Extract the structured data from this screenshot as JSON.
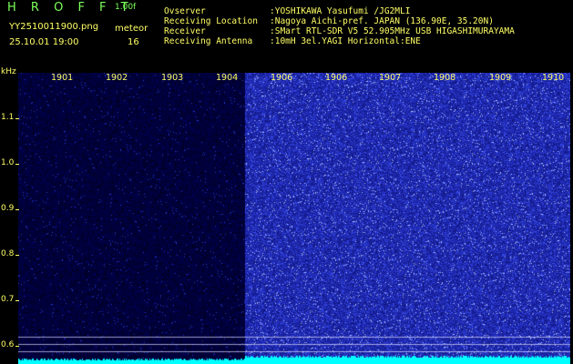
{
  "header": {
    "app_logo": "H R O F F T",
    "version": "1.00f",
    "filename": "YY2510011900.png",
    "meteor_label": "meteor",
    "datetime": "25.10.01 19:00",
    "meteor_count": "16"
  },
  "info": [
    {
      "key": "Ovserver",
      "value": ":YOSHIKAWA Yasufumi /JG2MLI"
    },
    {
      "key": "Receiving Location",
      "value": ":Nagoya Aichi-pref. JAPAN (136.90E, 35.20N)"
    },
    {
      "key": "Receiver",
      "value": ":SMart RTL-SDR V5 52.905MHz USB HIGASHIMURAYAMA"
    },
    {
      "key": "Receiving Antenna",
      "value": ":10mH 3el.YAGI Horizontal:ENE"
    }
  ],
  "y_unit": "kHz",
  "y_ticks": [
    "1.1",
    "1.0",
    "0.9",
    "0.8",
    "0.7",
    "0.6"
  ],
  "x_ticks": [
    "1901",
    "1902",
    "1903",
    "1904",
    "1906",
    "1906",
    "1907",
    "1908",
    "1909",
    "1910"
  ],
  "colors": {
    "background": "#000000",
    "label": "#ffff66",
    "logo": "#7cff5a",
    "spectrum_dark": "#0a0a5a",
    "spectrum_bright": "#2a3aff",
    "baseline": "#00ffff"
  }
}
